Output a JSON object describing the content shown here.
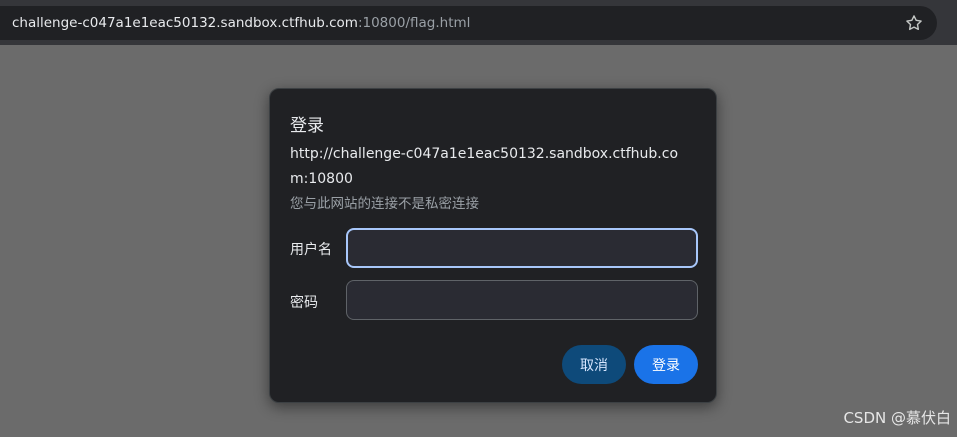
{
  "address_bar": {
    "host": "challenge-c047a1e1eac50132.sandbox.ctfhub.com",
    "path": ":10800/flag.html",
    "star_icon": "star-outline-icon"
  },
  "dialog": {
    "title": "登录",
    "origin": "http://challenge-c047a1e1eac50132.sandbox.ctfhub.com:10800",
    "warning": "您与此网站的连接不是私密连接",
    "username_label": "用户名",
    "password_label": "密码",
    "username_value": "",
    "password_value": "",
    "cancel_label": "取消",
    "login_label": "登录"
  },
  "watermark": "CSDN @慕伏白",
  "colors": {
    "toolbar": "#35363a",
    "omnibox": "#202124",
    "page_background": "#6b6b6b",
    "dialog_background": "#202124",
    "focus_ring": "#a8c7fa",
    "primary_button": "#1a73e8",
    "secondary_button": "#0e4a7a"
  }
}
